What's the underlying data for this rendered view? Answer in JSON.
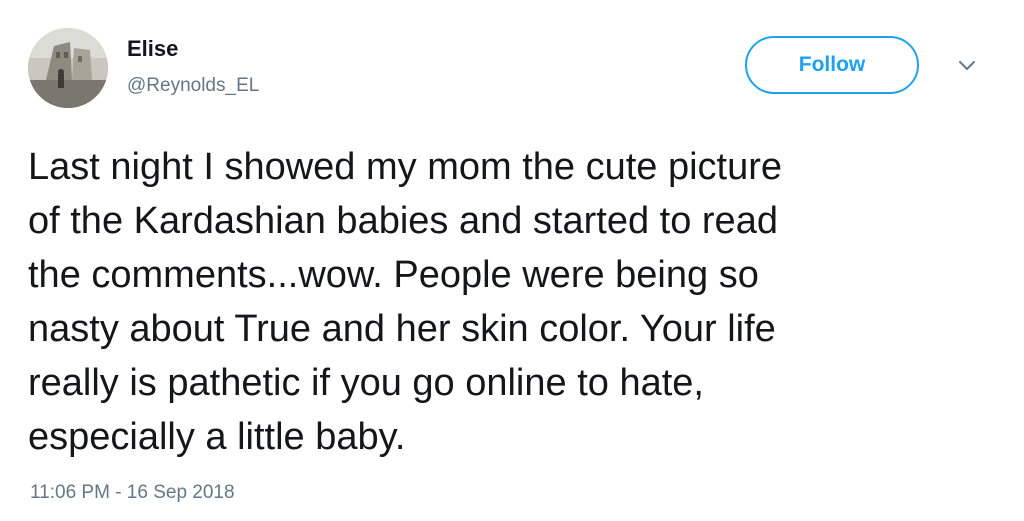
{
  "user": {
    "name": "Elise",
    "handle": "@Reynolds_EL",
    "avatar_icon": "profile-photo"
  },
  "follow_label": "Follow",
  "menu_icon": "chevron-down-icon",
  "tweet": {
    "lines": [
      "Last night I showed my mom the cute picture",
      "of the Kardashian babies and started to read",
      "the comments...wow. People were being so",
      "nasty about True and her skin color. Your life",
      "really is pathetic if you go online to hate,",
      "especially a little baby."
    ]
  },
  "timestamp": "11:06 PM - 16 Sep 2018",
  "colors": {
    "accent": "#1da1f2",
    "text": "#14171a",
    "secondary": "#657786"
  }
}
